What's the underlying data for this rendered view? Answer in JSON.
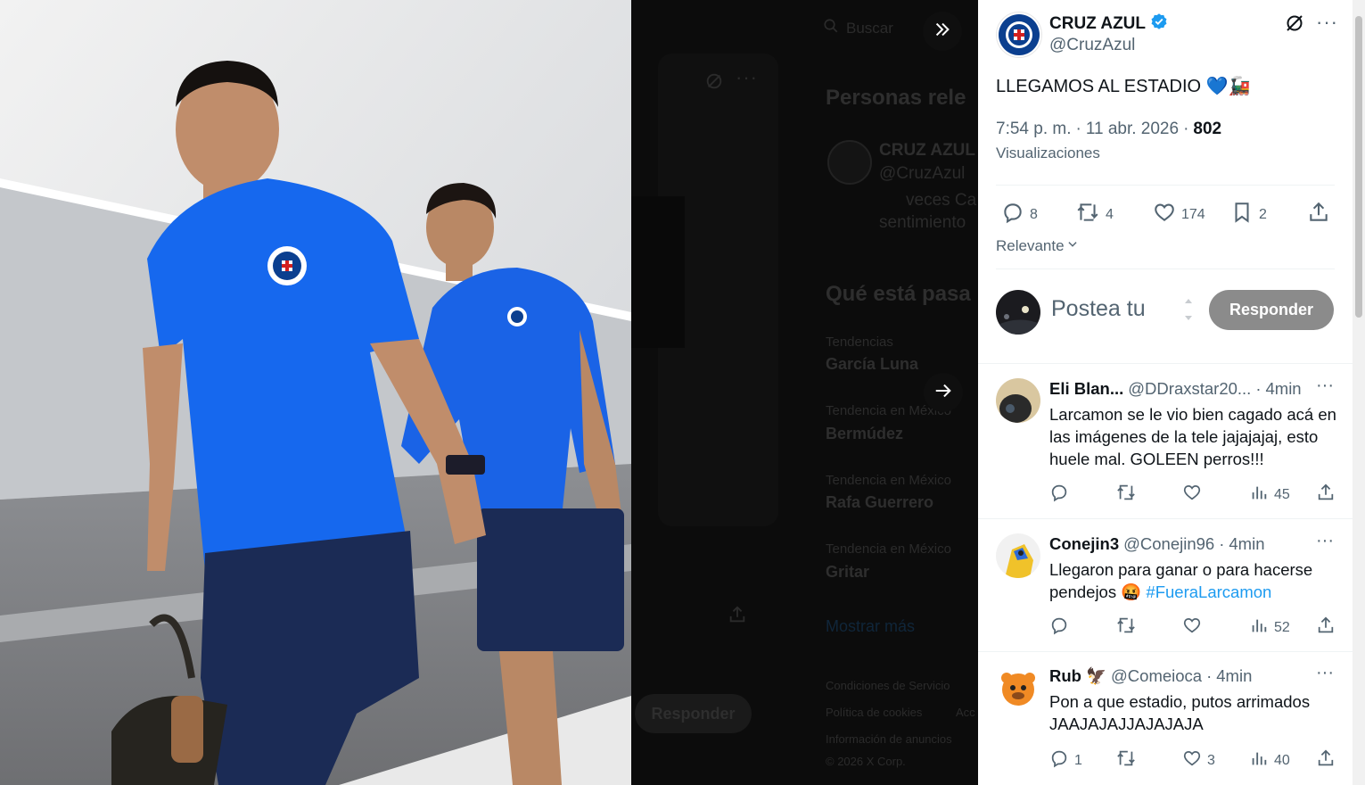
{
  "search": {
    "placeholder": "Buscar"
  },
  "background": {
    "section_people": "Personas rele",
    "people_name": "CRUZ AZUL",
    "people_handle": "@CruzAzul",
    "people_bio_line1": "veces Ca",
    "people_bio_line2": "sentimiento",
    "section_trends": "Qué está pasa",
    "trends": [
      {
        "context": "Tendencias",
        "name": "García Luna"
      },
      {
        "context": "Tendencia en México",
        "name": "Bermúdez"
      },
      {
        "context": "Tendencia en México",
        "name": "Rafa Guerrero"
      },
      {
        "context": "Tendencia en México",
        "name": "Gritar"
      }
    ],
    "show_more": "Mostrar más",
    "reply_button": "Responder",
    "footer": [
      "Condiciones de Servicio",
      "Política de cookies",
      "Acc",
      "Información de anuncios",
      "© 2026 X Corp."
    ]
  },
  "post": {
    "author_name": "CRUZ AZUL",
    "author_handle": "@CruzAzul",
    "text": "LLEGAMOS AL ESTADIO 💙🚂",
    "time": "7:54 p. m.",
    "dot1": "·",
    "date": "11 abr. 2026",
    "dot2": "·",
    "views": "802",
    "views_label": "Visualizaciones",
    "stats": {
      "replies": "8",
      "reposts": "4",
      "likes": "174",
      "bookmarks": "2"
    },
    "sort_label": "Relevante"
  },
  "composer": {
    "placeholder": "Postea tu",
    "button": "Responder"
  },
  "replies": [
    {
      "name": "Eli Blan...",
      "badge": "",
      "handle": "@DDraxstar20...",
      "dot": "·",
      "time": "4min",
      "text": "Larcamon se le vio bien cagado acá en las imágenes de la tele jajajajaj, esto huele mal. GOLEEN perros!!!",
      "hashtag": "",
      "reply_count": "",
      "repost_count": "",
      "like_count": "",
      "views": "45"
    },
    {
      "name": "Conejin3",
      "badge": "",
      "handle": "@Conejin96",
      "dot": "·",
      "time": "4min",
      "text": "Llegaron para ganar o para hacerse pendejos 🤬 ",
      "hashtag": "#FueraLarcamon",
      "reply_count": "",
      "repost_count": "",
      "like_count": "",
      "views": "52"
    },
    {
      "name": "Rub",
      "badge": "🦅",
      "handle": "@Comeioca",
      "dot": "·",
      "time": "4min",
      "text": "Pon a que estadio, putos arrimados JAAJAJAJJAJAJAJA",
      "hashtag": "",
      "reply_count": "1",
      "repost_count": "",
      "like_count": "3",
      "views": "40"
    }
  ],
  "colors": {
    "accent": "#1d9bf0",
    "club_blue": "#0b3f8f",
    "button_gray": "#8b8b8b",
    "text": "#0f1419",
    "secondary": "#536471"
  },
  "icons": [
    "search-icon",
    "collapse-double-chevron-icon",
    "next-arrow-icon",
    "grok-icon",
    "more-icon",
    "verified-badge-icon",
    "reply-icon",
    "repost-icon",
    "like-icon",
    "bookmark-icon",
    "share-icon",
    "views-icon",
    "chevron-down-icon"
  ]
}
